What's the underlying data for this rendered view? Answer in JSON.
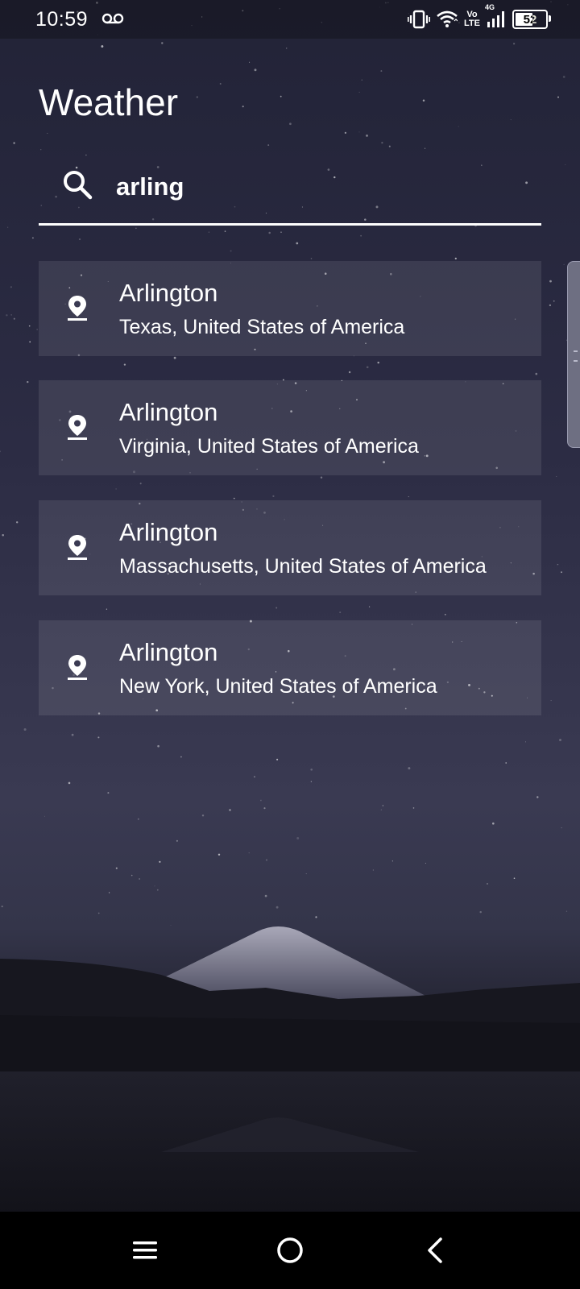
{
  "status": {
    "time": "10:59",
    "battery_level": "52",
    "volte_top": "Vo",
    "volte_bottom": "LTE",
    "network": "4G"
  },
  "header": {
    "title": "Weather"
  },
  "search": {
    "value": "arling"
  },
  "results": [
    {
      "city": "Arlington",
      "region": "Texas, United States of America"
    },
    {
      "city": "Arlington",
      "region": "Virginia, United States of America"
    },
    {
      "city": "Arlington",
      "region": "Massachusetts, United States of America"
    },
    {
      "city": "Arlington",
      "region": "New York, United States of America"
    }
  ],
  "nav": {
    "menu": "menu-icon",
    "home": "home-icon",
    "back": "back-icon"
  }
}
